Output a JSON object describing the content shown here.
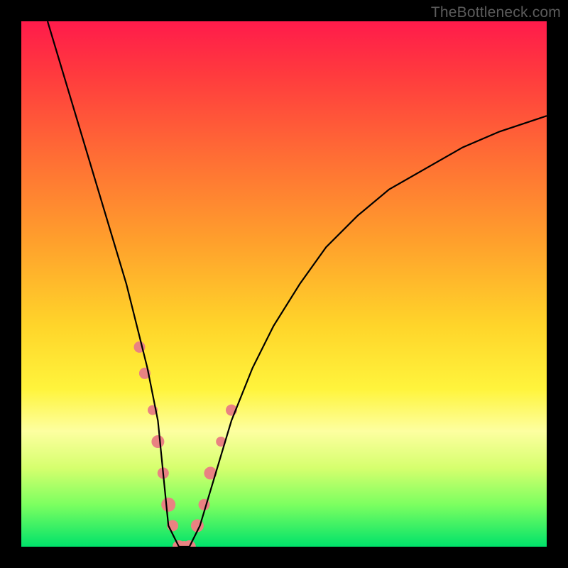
{
  "watermark": "TheBottleneck.com",
  "chart_data": {
    "type": "line",
    "title": "",
    "xlabel": "",
    "ylabel": "",
    "xlim": [
      0,
      100
    ],
    "ylim": [
      0,
      100
    ],
    "series": [
      {
        "name": "curve",
        "x": [
          5,
          8,
          11,
          14,
          17,
          20,
          22,
          24,
          26,
          27,
          28,
          30,
          32,
          34,
          37,
          40,
          44,
          48,
          53,
          58,
          64,
          70,
          77,
          84,
          91,
          100
        ],
        "y": [
          100,
          90,
          80,
          70,
          60,
          50,
          42,
          34,
          24,
          14,
          4,
          0,
          0,
          4,
          14,
          24,
          34,
          42,
          50,
          57,
          63,
          68,
          72,
          76,
          79,
          82
        ]
      }
    ],
    "markers": {
      "name": "highlight-points",
      "x": [
        22.5,
        23.5,
        25.0,
        26.0,
        27.0,
        28.0,
        28.8,
        30.0,
        31.0,
        32.0,
        33.5,
        34.8,
        36.0,
        38.0,
        40.0
      ],
      "y": [
        38,
        33,
        26,
        20,
        14,
        8,
        4,
        0,
        0,
        0,
        4,
        8,
        14,
        20,
        26
      ],
      "r": [
        8,
        8,
        7,
        9,
        8,
        10,
        8,
        9,
        8,
        9,
        9,
        8,
        9,
        7,
        8
      ]
    }
  }
}
